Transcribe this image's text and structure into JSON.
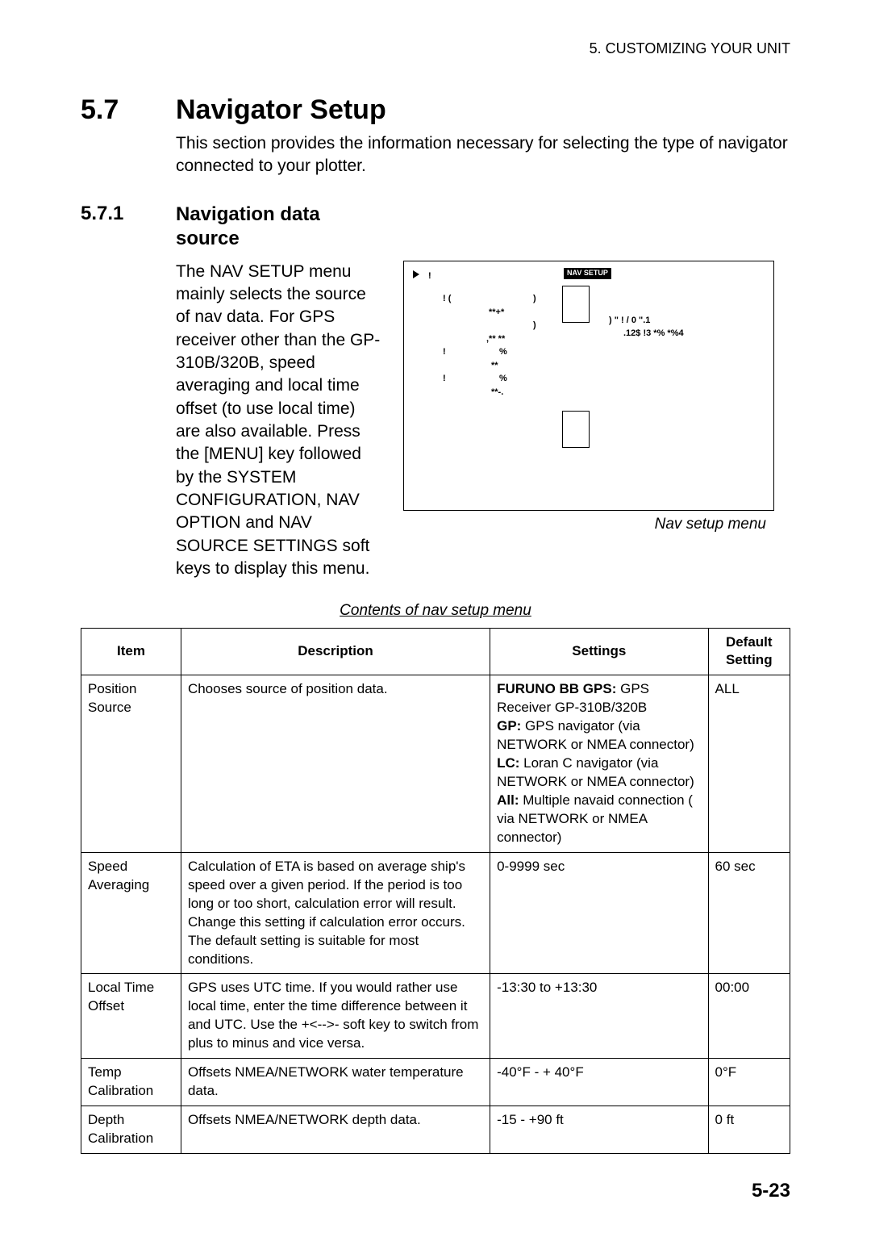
{
  "header": {
    "chapter": "5. CUSTOMIZING YOUR UNIT"
  },
  "section": {
    "num": "5.7",
    "title": "Navigator Setup",
    "intro": "This section provides the information necessary for selecting the type of navigator connected to your plotter."
  },
  "subsection": {
    "num": "5.7.1",
    "title": "Navigation data source",
    "body": "The NAV SETUP menu mainly selects the source of nav data. For GPS receiver other than the GP-310B/320B, speed averaging and local time offset (to use local time) are also available. Press the [MENU] key followed by the SYSTEM CONFIGURATION, NAV OPTION and NAV SOURCE SETTINGS soft keys to display this menu."
  },
  "figure": {
    "nav_setup_label": "NAV\nSETUP",
    "rows": [
      {
        "label": "!",
        "val": ""
      },
      {
        "label": "! (",
        "val": ")"
      },
      {
        "label": "",
        "val": "**+*"
      },
      {
        "label": "",
        "val": ")"
      },
      {
        "label": "",
        "val": ",** **"
      },
      {
        "label": "!",
        "val": "%"
      },
      {
        "label": "",
        "val": "**"
      },
      {
        "label": "!",
        "val": "%"
      },
      {
        "label": "",
        "val": "**-."
      }
    ],
    "side": {
      "l1": ")     \"     !      /    0      \".1",
      "l2": ".12$   !3   *%     *%4"
    },
    "caption": "Nav setup menu"
  },
  "table": {
    "caption": "Contents of nav setup menu",
    "headers": [
      "Item",
      "Description",
      "Settings",
      "Default Setting"
    ],
    "rows": [
      {
        "item": "Position Source",
        "desc": "Chooses source of position data.",
        "settings_bold1": "FURUNO BB GPS:",
        "settings_after1": " GPS Receiver GP-310B/320B",
        "settings_bold2": "GP:",
        "settings_after2": " GPS navigator (via NETWORK or NMEA connector)",
        "settings_bold3": "LC:",
        "settings_after3": " Loran C navigator (via NETWORK or NMEA connector)",
        "settings_bold4": "All:",
        "settings_after4": " Multiple navaid connection ( via NETWORK or NMEA connector)",
        "default": "ALL"
      },
      {
        "item": "Speed Averaging",
        "desc": "Calculation of ETA is based on average ship's speed over a given period. If the period is too long or too short, calculation error will result. Change this setting if calculation error occurs. The default setting is suitable for most conditions.",
        "settings": "0-9999 sec",
        "default": "60 sec"
      },
      {
        "item": "Local Time Offset",
        "desc": "GPS uses UTC time. If you would rather use local time, enter the time difference between it and UTC. Use the +<-->- soft key to switch from plus to minus and vice versa.",
        "settings": "-13:30 to +13:30",
        "default": "00:00"
      },
      {
        "item": "Temp Calibration",
        "desc": "Offsets NMEA/NETWORK water temperature data.",
        "settings": "-40°F - + 40°F",
        "default": "0°F"
      },
      {
        "item": "Depth Calibration",
        "desc": "Offsets NMEA/NETWORK depth data.",
        "settings": "-15 - +90 ft",
        "default": "0 ft"
      }
    ]
  },
  "pagenum": "5-23"
}
